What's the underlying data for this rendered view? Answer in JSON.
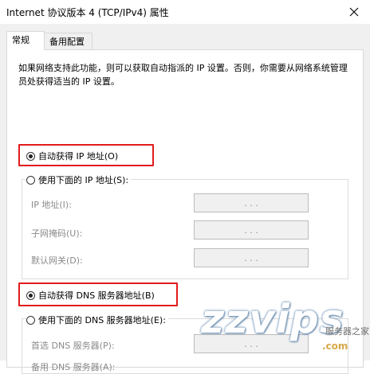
{
  "window": {
    "title": "Internet 协议版本 4 (TCP/IPv4) 属性",
    "close_symbol": "✕"
  },
  "tabs": [
    {
      "label": "常规",
      "active": true
    },
    {
      "label": "备用配置",
      "active": false
    }
  ],
  "description": "如果网络支持此功能，则可以获取自动指派的 IP 设置。否则，你需要从网络系统管理员处获得适当的 IP 设置。",
  "ip_section": {
    "auto_label": "自动获得 IP 地址(O)",
    "auto_selected": true,
    "manual_label": "使用下面的 IP 地址(S):",
    "manual_selected": false,
    "fields": [
      {
        "label": "IP 地址(I):",
        "value": ". . ."
      },
      {
        "label": "子网掩码(U):",
        "value": ". . ."
      },
      {
        "label": "默认网关(D):",
        "value": ". . ."
      }
    ]
  },
  "dns_section": {
    "auto_label": "自动获得 DNS 服务器地址(B)",
    "auto_selected": true,
    "manual_label": "使用下面的 DNS 服务器地址(E):",
    "manual_selected": false,
    "fields": [
      {
        "label": "首选 DNS 服务器(P):",
        "value": ". . ."
      },
      {
        "label": "备用 DNS 服务器(A):",
        "value": ". . ."
      }
    ]
  },
  "watermark": {
    "text": "zzvips",
    "sub": "服务器之家",
    "domain": ".com"
  },
  "colors": {
    "highlight_frame": "#e11b1b"
  }
}
